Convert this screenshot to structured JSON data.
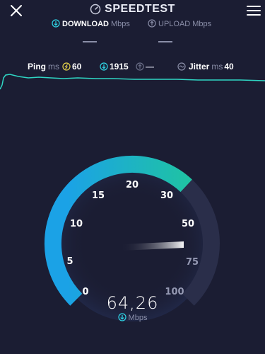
{
  "app": {
    "title": "SPEEDTEST"
  },
  "tabs": {
    "download": {
      "label": "DOWNLOAD",
      "unit": "Mbps"
    },
    "upload": {
      "label": "UPLOAD",
      "unit": "Mbps"
    }
  },
  "stats": {
    "ping": {
      "label": "Ping",
      "unit": "ms",
      "value": "60"
    },
    "download": {
      "value": "1915"
    },
    "upload": {
      "value": "—"
    },
    "jitter": {
      "label": "Jitter",
      "unit": "ms",
      "value": "40"
    }
  },
  "gauge": {
    "scale_labels": [
      "0",
      "5",
      "10",
      "15",
      "20",
      "30",
      "50",
      "75",
      "100"
    ],
    "value": "64,26",
    "unit": "Mbps",
    "level_fraction": 0.66
  },
  "colors": {
    "background": "#1b1d33",
    "gauge_start": "#1ba2e6",
    "gauge_end": "#20c997",
    "graph_line": "#2fd6c4",
    "track": "#2a2e4a"
  },
  "icons": {
    "close": "close-icon",
    "speedometer": "speedometer-icon",
    "menu": "menu-icon",
    "download": "download-arrow-icon",
    "upload": "upload-arrow-icon",
    "ping": "ping-icon",
    "jitter": "jitter-icon"
  }
}
